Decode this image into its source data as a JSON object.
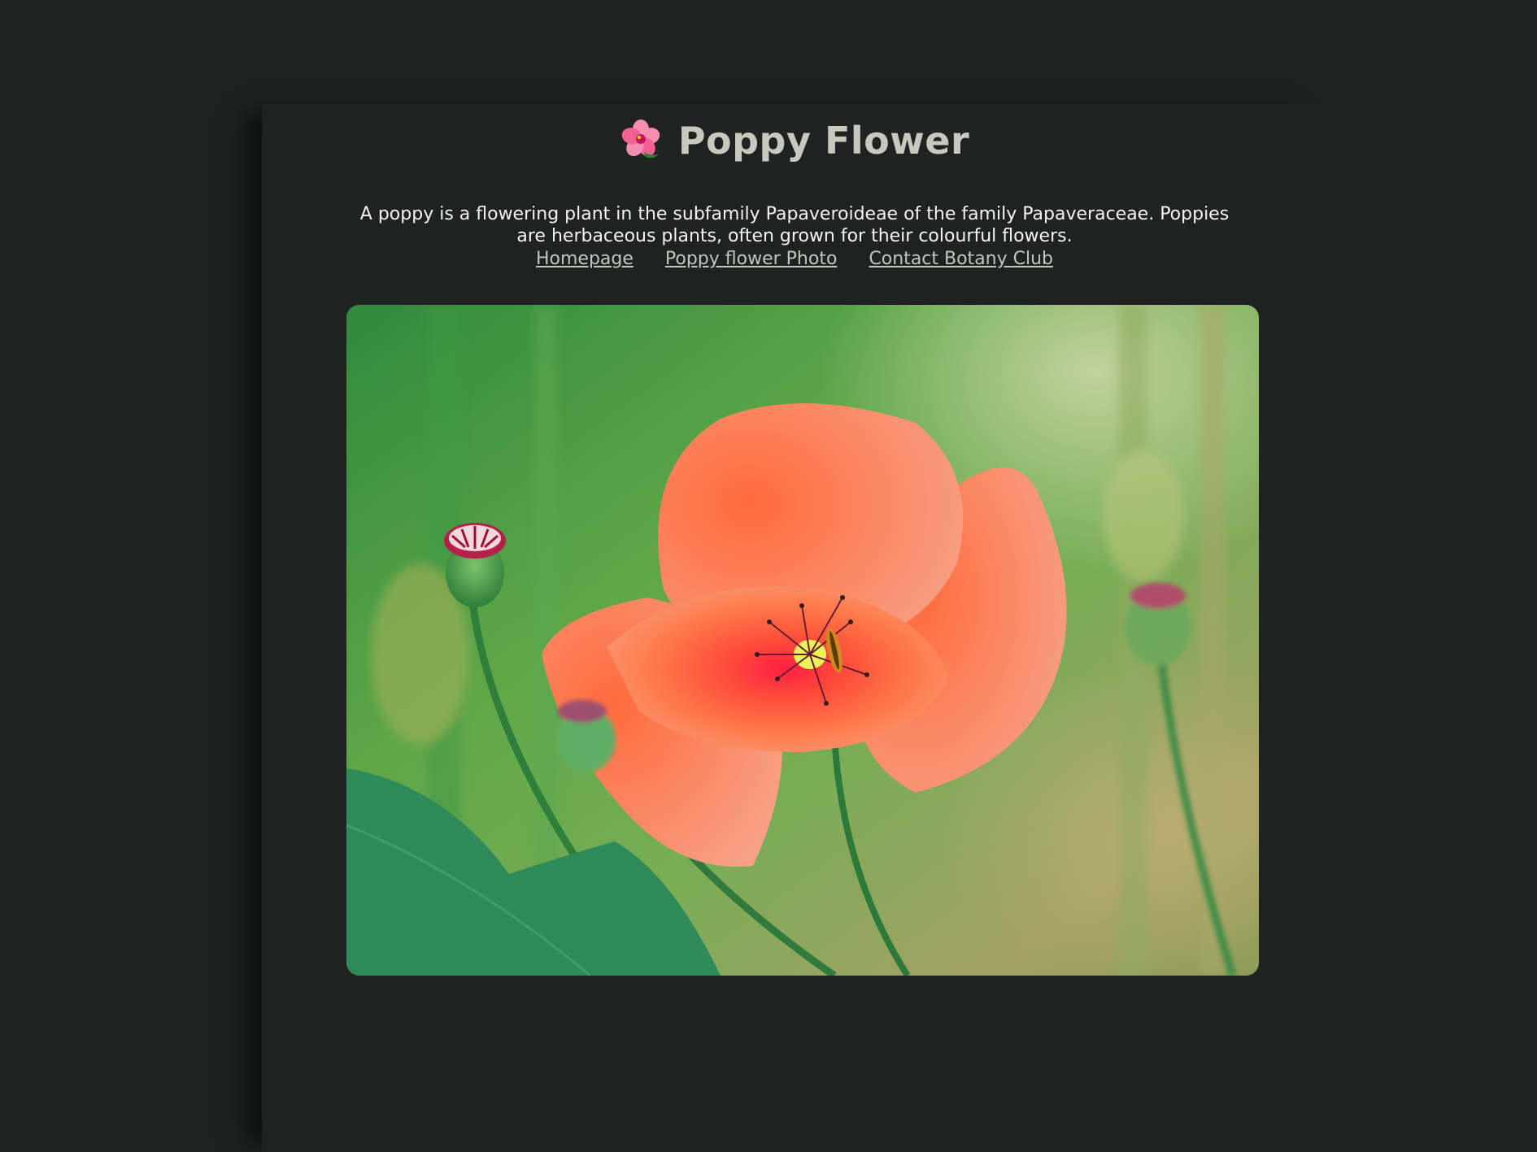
{
  "page": {
    "title": "Poppy Flower",
    "title_icon": "hibiscus-icon",
    "description": "A poppy is a flowering plant in the subfamily Papaveroideae of the family Papaveraceae. Poppies are herbaceous plants, often grown for their colourful flowers."
  },
  "nav": {
    "links": [
      {
        "label": "Homepage"
      },
      {
        "label": "Poppy flower Photo"
      },
      {
        "label": "Contact Botany Club"
      }
    ]
  },
  "colors": {
    "background": "#1f2221",
    "title": "#c7c9bf",
    "link": "#c3c6bb",
    "text": "#f4f4f1"
  }
}
